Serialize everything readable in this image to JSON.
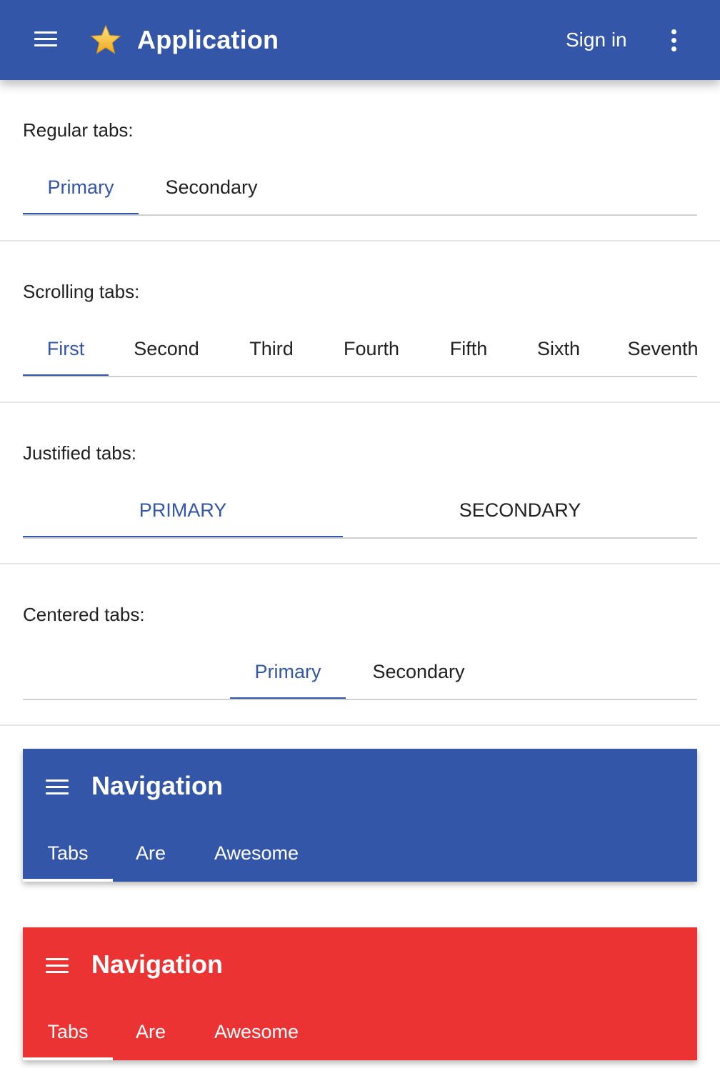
{
  "appbar": {
    "title": "Application",
    "signin_label": "Sign in",
    "icons": {
      "menu": "menu-icon",
      "logo": "star-icon",
      "more": "more-vert-icon"
    },
    "background": "#3456a9"
  },
  "regular": {
    "label": "Regular tabs:",
    "tabs": [
      {
        "label": "Primary",
        "active": true
      },
      {
        "label": "Secondary",
        "active": false
      }
    ]
  },
  "scrolling": {
    "label": "Scrolling tabs:",
    "tabs": [
      {
        "label": "First",
        "active": true
      },
      {
        "label": "Second",
        "active": false
      },
      {
        "label": "Third",
        "active": false
      },
      {
        "label": "Fourth",
        "active": false
      },
      {
        "label": "Fifth",
        "active": false
      },
      {
        "label": "Sixth",
        "active": false
      },
      {
        "label": "Seventh",
        "active": false
      }
    ]
  },
  "justified": {
    "label": "Justified tabs:",
    "tabs": [
      {
        "label": "PRIMARY",
        "active": true
      },
      {
        "label": "SECONDARY",
        "active": false
      }
    ]
  },
  "centered": {
    "label": "Centered tabs:",
    "tabs": [
      {
        "label": "Primary",
        "active": true
      },
      {
        "label": "Secondary",
        "active": false
      }
    ]
  },
  "nav_blue": {
    "title": "Navigation",
    "color": "#3456a9",
    "tabs": [
      {
        "label": "Tabs",
        "active": true
      },
      {
        "label": "Are",
        "active": false
      },
      {
        "label": "Awesome",
        "active": false
      }
    ]
  },
  "nav_red": {
    "title": "Navigation",
    "color": "#ec3333",
    "tabs": [
      {
        "label": "Tabs",
        "active": true
      },
      {
        "label": "Are",
        "active": false
      },
      {
        "label": "Awesome",
        "active": false
      }
    ]
  },
  "colors": {
    "accent": "#3456a9",
    "text": "#212121",
    "danger": "#ec3333"
  }
}
